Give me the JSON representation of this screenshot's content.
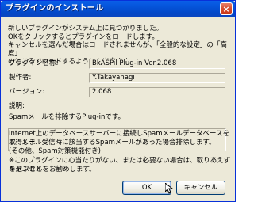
{
  "window": {
    "title": "プラグインのインストール",
    "close_label": "×"
  },
  "message": {
    "line1": "新しいプラグインがシステム上に見つかりました。",
    "line2": "OKをクリックするとプラグインをロードします。",
    "line3": "キャンセルを選んだ場合はロードされませんが、「全般的な設定」の「高度」",
    "line4": "のところでロードするようにも出来ます。"
  },
  "fields": {
    "plugin_name": {
      "label": "プラグイン名称:",
      "value": "BkASPil Plug-in Ver.2.068"
    },
    "author": {
      "label": "製作者:",
      "value": "Y.Takayanagi"
    },
    "version": {
      "label": "バージョン:",
      "value": "2.068"
    },
    "description_label": "説明:"
  },
  "description": {
    "line1": "Spamメールを排除するPlug-inです。",
    "line2": "Internet上のデータベースサーバーに接続しSpamメールデータベースを取得しま",
    "line3": "す。メール受信時に該当するSpamメールがあった場合排除します。",
    "line4": "(その他、Spam対策機能付き)"
  },
  "warning": {
    "line1": "※このプラグインに心当たりがない、または必要ない場合は、取りあえずキャンセル",
    "line2": "を選ぶことをお勧めします。"
  },
  "buttons": {
    "ok": "OK",
    "cancel": "キャンセル"
  }
}
